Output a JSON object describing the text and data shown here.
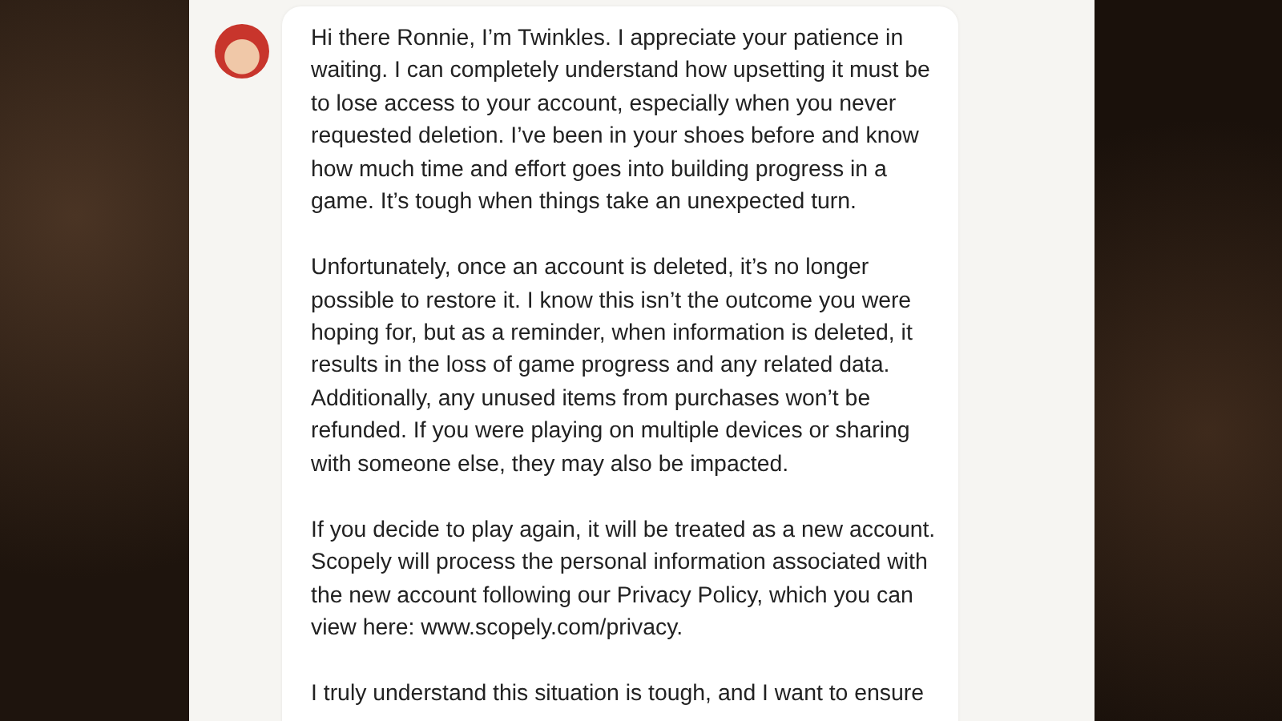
{
  "chat": {
    "messages": [
      {
        "paragraphs": [
          "Hi there Ronnie, I’m Twinkles. I appreciate your patience in waiting. I can completely understand how upsetting it must be to lose access to your account, especially when you never requested deletion. I’ve been in your shoes before and know how much time and effort goes into building progress in a game. It’s tough when things take an unexpected turn.",
          "Unfortunately, once an account is deleted, it’s no longer possible to restore it. I know this isn’t the outcome you were hoping for, but as a reminder, when information is deleted, it results in the loss of game progress and any related data. Additionally, any unused items from purchases won’t be refunded. If you were playing on multiple devices or sharing with someone else, they may also be impacted.",
          "If you decide to play again, it will be treated as a new account. Scopely will process the personal information associated with the new account following our Privacy Policy, which you can view here: www.scopely.com/privacy.",
          "I truly understand this situation is tough, and I want to ensure"
        ]
      }
    ]
  }
}
